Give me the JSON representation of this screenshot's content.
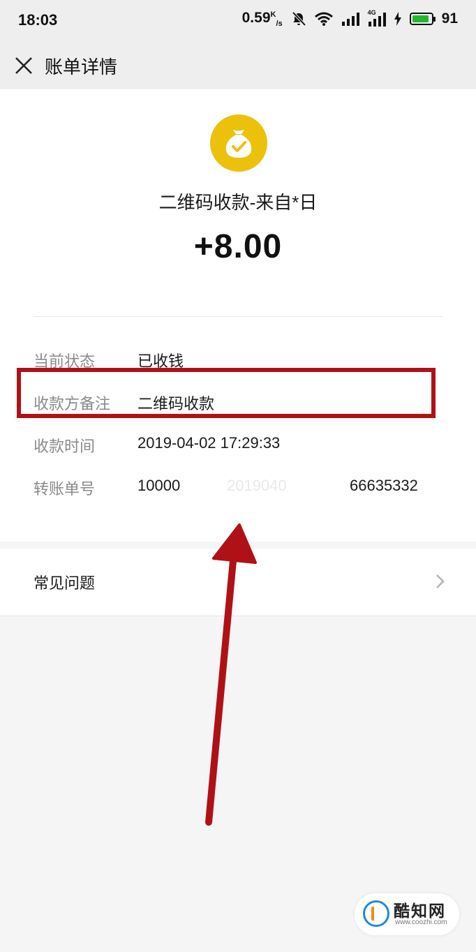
{
  "status_bar": {
    "time": "18:03",
    "speed": "0.59",
    "speed_unit_top": "K",
    "speed_unit_bottom": "/s",
    "network_label": "4G",
    "battery": "91",
    "battery_level": 0.91,
    "battery_color": "#21b82f"
  },
  "header": {
    "title": "账单详情",
    "close_icon": "close-icon"
  },
  "bill": {
    "icon": "money-bag-check-icon",
    "icon_color": "#ecc10b",
    "payee": "二维码收款-来自*日",
    "amount": "+8.00",
    "rows": [
      {
        "label": "当前状态",
        "value": "已收钱"
      },
      {
        "label": "收款方备注",
        "value": "二维码收款"
      },
      {
        "label": "收款时间",
        "value": "2019-04-02 17:29:33"
      },
      {
        "label": "转账单号",
        "value_start": "10000",
        "value_blurred_1": "2019040",
        "value_end": "66635332"
      }
    ]
  },
  "annotation": {
    "highlight_color": "#b01116"
  },
  "faq": {
    "label": "常见问题",
    "chevron_icon": "chevron-right-icon"
  },
  "watermark": {
    "name": "酷知网",
    "url": "www.coozhi.com"
  }
}
